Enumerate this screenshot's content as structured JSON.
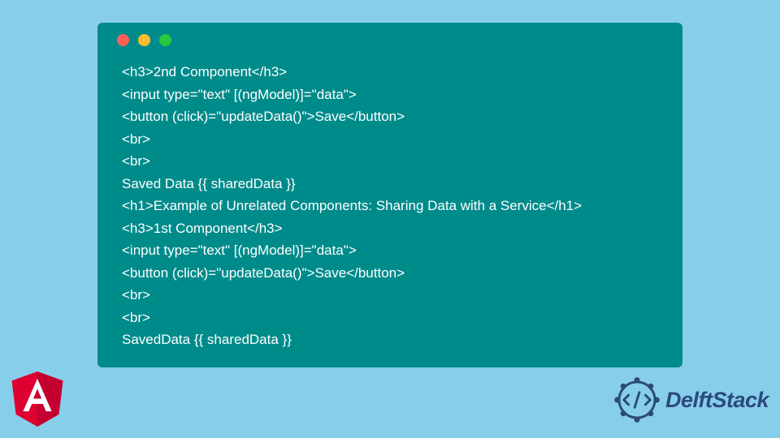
{
  "code": {
    "lines": [
      "<h3>2nd Component</h3>",
      "<input type=\"text\" [(ngModel)]=\"data\">",
      "<button (click)=\"updateData()\">Save</button>",
      "<br>",
      "<br>",
      "Saved Data {{ sharedData }}",
      "<h1>Example of Unrelated Components: Sharing Data with a Service</h1>",
      "<h3>1st Component</h3>",
      "<input type=\"text\" [(ngModel)]=\"data\">",
      "<button (click)=\"updateData()\">Save</button>",
      "<br>",
      "<br>",
      "SavedData {{ sharedData }}"
    ]
  },
  "branding": {
    "delftstack_label": "DelftStack"
  },
  "colors": {
    "background": "#87ceeb",
    "window": "#008b8b",
    "code_text": "#ffffff",
    "dot_red": "#ff5f56",
    "dot_yellow": "#ffbd2e",
    "dot_green": "#27c93f",
    "angular_red": "#dd0031",
    "delftstack_blue": "#2b4a7a"
  }
}
